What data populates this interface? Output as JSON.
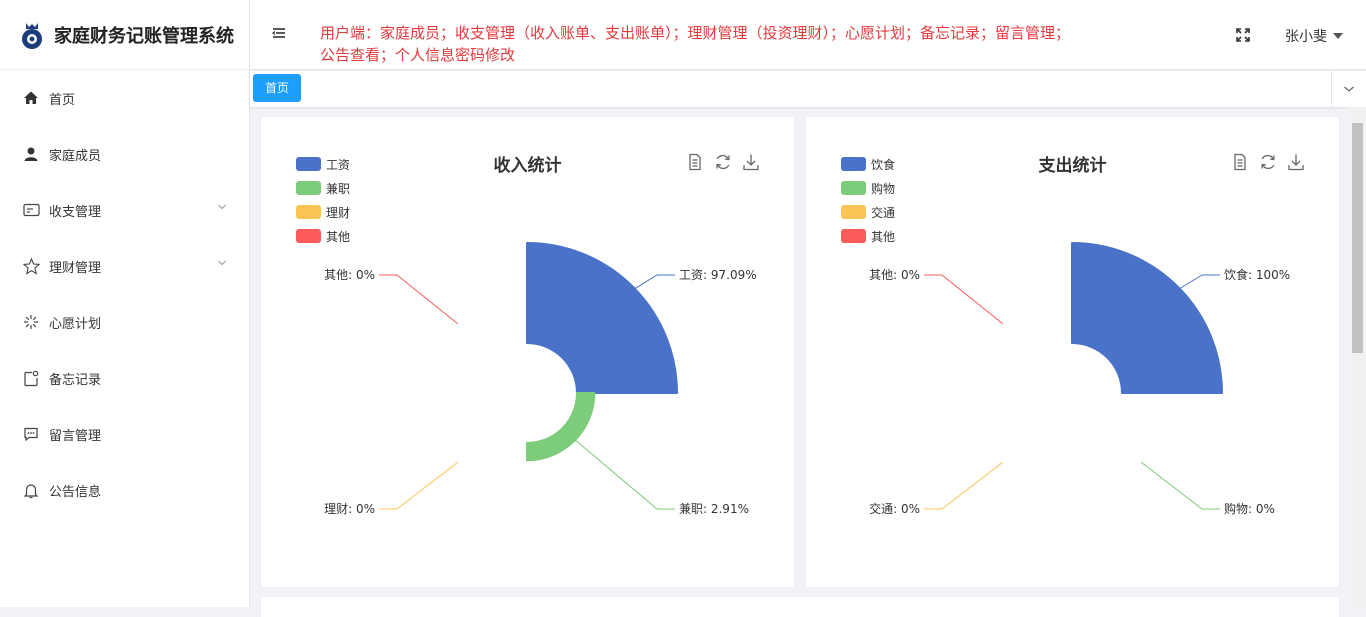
{
  "app": {
    "title": "家庭财务记账管理系统"
  },
  "header": {
    "notice_line1": "用户端：家庭成员；收支管理（收入账单、支出账单）；理财管理（投资理财）；心愿计划；备忘记录；留言管理；",
    "notice_line2": "公告查看；个人信息密码修改",
    "username": "张小斐"
  },
  "sidebar": {
    "items": [
      {
        "label": "首页",
        "icon": "home-icon"
      },
      {
        "label": "家庭成员",
        "icon": "user-icon"
      },
      {
        "label": "收支管理",
        "icon": "wallet-icon",
        "has_submenu": true
      },
      {
        "label": "理财管理",
        "icon": "star-icon",
        "has_submenu": true
      },
      {
        "label": "心愿计划",
        "icon": "loading-icon"
      },
      {
        "label": "备忘记录",
        "icon": "note-icon"
      },
      {
        "label": "留言管理",
        "icon": "message-icon"
      },
      {
        "label": "公告信息",
        "icon": "bell-icon"
      }
    ]
  },
  "tabs": {
    "active": "首页"
  },
  "colors": {
    "blue": "#4a72c8",
    "green": "#7ccc7b",
    "yellow": "#fcc556",
    "red": "#fb5b5b",
    "notice": "#e4393c",
    "accent": "#1e9fff"
  },
  "chart_data": [
    {
      "type": "pie",
      "title": "收入统计",
      "categories": [
        "工资",
        "兼职",
        "理财",
        "其他"
      ],
      "values": [
        97.09,
        2.91,
        0,
        0
      ],
      "labels": [
        "工资: 97.09%",
        "兼职: 2.91%",
        "理财: 0%",
        "其他: 0%"
      ],
      "legend_position": "top-left",
      "rose": true
    },
    {
      "type": "pie",
      "title": "支出统计",
      "categories": [
        "饮食",
        "购物",
        "交通",
        "其他"
      ],
      "values": [
        100,
        0,
        0,
        0
      ],
      "labels": [
        "饮食: 100%",
        "购物: 0%",
        "交通: 0%",
        "其他: 0%"
      ],
      "legend_position": "top-left",
      "rose": true
    }
  ]
}
